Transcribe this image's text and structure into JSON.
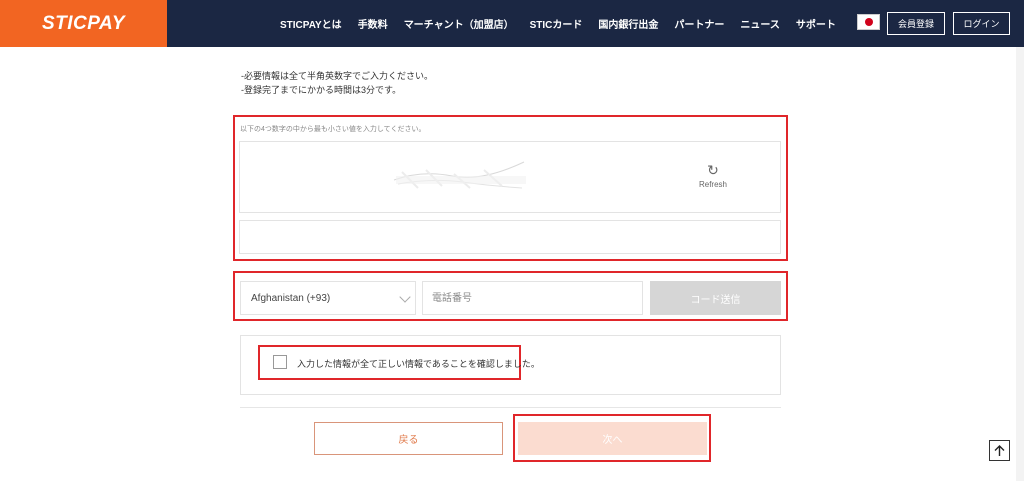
{
  "header": {
    "logo": "STICPAY",
    "nav": [
      "STICPAYとは",
      "手数料",
      "マーチャント（加盟店）",
      "STICカード",
      "国内銀行出金",
      "パートナー",
      "ニュース",
      "サポート"
    ],
    "register_label": "会員登録",
    "login_label": "ログイン",
    "flag_icon": "japan-flag-icon"
  },
  "notes": [
    "-必要情報は全て半角英数字でご入力ください。",
    "-登録完了までにかかる時間は3分です。"
  ],
  "captcha": {
    "hint": "以下の4つ数字の中から最も小さい値を入力してください。",
    "refresh_label": "Refresh",
    "refresh_icon": "refresh-icon",
    "input_value": ""
  },
  "phone": {
    "country_selected": "Afghanistan (+93)",
    "phone_placeholder": "電話番号",
    "send_code_label": "コード送信"
  },
  "confirm": {
    "label": "入力した情報が全て正しい情報であることを確認しました。",
    "checked": false
  },
  "buttons": {
    "back": "戻る",
    "next": "次へ"
  },
  "colors": {
    "brand_orange": "#f26522",
    "header_navy": "#1b2743",
    "highlight_red": "#e0262a"
  }
}
